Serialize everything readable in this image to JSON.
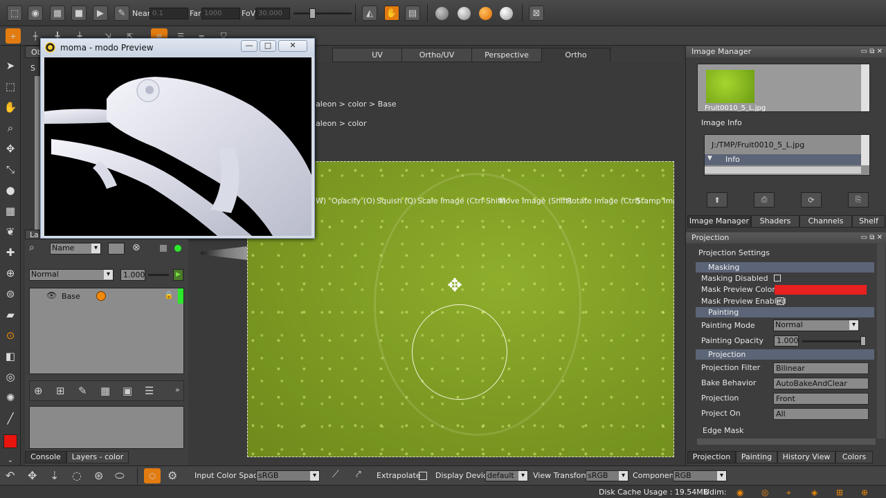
{
  "colors": {
    "accent": "#f08a0a",
    "mask_red": "#e82020",
    "texture_green": "#86a62a",
    "panel_highlight": "#5c6477"
  },
  "top_toolbar": {
    "near_label": "Near",
    "near_value": "0.1",
    "far_label": "Far",
    "far_value": "1000",
    "fov_label": "FoV",
    "fov_value": "30.000"
  },
  "preview_window": {
    "title": "moma - modo Preview",
    "minimize": "—",
    "maximize": "□",
    "close": "✕"
  },
  "viewport": {
    "tabs": [
      "UV",
      "Ortho/UV",
      "Perspective",
      "Ortho"
    ],
    "active_tab": "Ortho",
    "breadcrumb_1": "aleon > color > Base",
    "breadcrumb_2": "aleon > color",
    "hints": [
      "W)",
      "Opacity (O)",
      "Squish (Q)",
      "Scale Image (Ctrl-Shift)",
      "Move Image (Shift)",
      "Rotate Image (Ctrl)",
      "Stamp Imag"
    ]
  },
  "left_panel": {
    "tab_obj": "Ob",
    "tab_lay": "La",
    "sub_label": "S"
  },
  "layers": {
    "filter_mode": "Name",
    "blend_mode": "Normal",
    "opacity": "1.000",
    "items": [
      {
        "name": "Base"
      }
    ],
    "bottom_tabs": [
      "Console",
      "Layers - color"
    ]
  },
  "image_manager": {
    "title": "Image Manager",
    "thumb_caption": "Fruit0010_5_L.jpg",
    "info_title": "Image Info",
    "path": "J:/TMP/Fruit0010_5_L.jpg",
    "info_row": "Info",
    "tabs": [
      "Image Manager",
      "Shaders",
      "Channels",
      "Shelf"
    ]
  },
  "projection": {
    "title": "Projection",
    "settings_label": "Projection Settings",
    "masking_group": "Masking",
    "masking_disabled_label": "Masking Disabled",
    "mask_preview_color_label": "Mask Preview Color",
    "mask_preview_enabled_label": "Mask Preview Enabled",
    "painting_group": "Painting",
    "painting_mode_label": "Painting Mode",
    "painting_mode_value": "Normal",
    "painting_opacity_label": "Painting Opacity",
    "painting_opacity_value": "1.000",
    "projection_group": "Projection",
    "projection_filter_label": "Projection Filter",
    "projection_filter_value": "Bilinear",
    "bake_behavior_label": "Bake Behavior",
    "bake_behavior_value": "AutoBakeAndClear",
    "projection_label": "Projection",
    "projection_value": "Front",
    "project_on_label": "Project On",
    "project_on_value": "All",
    "edge_mask_label": "Edge Mask",
    "tabs": [
      "Projection",
      "Painting",
      "History View",
      "Colors"
    ]
  },
  "bottom_toolbar": {
    "input_color_space_label": "Input Color Space",
    "input_color_space_value": "sRGB",
    "extrapolate_label": "Extrapolate",
    "display_device_label": "Display Device",
    "display_device_value": "default",
    "view_transform_label": "View Transform",
    "view_transform_value": "sRGB",
    "component_label": "Component",
    "component_value": "RGB"
  },
  "status": {
    "disk_cache": "Disk Cache Usage : 19.54MB",
    "udim": "Udim:"
  }
}
